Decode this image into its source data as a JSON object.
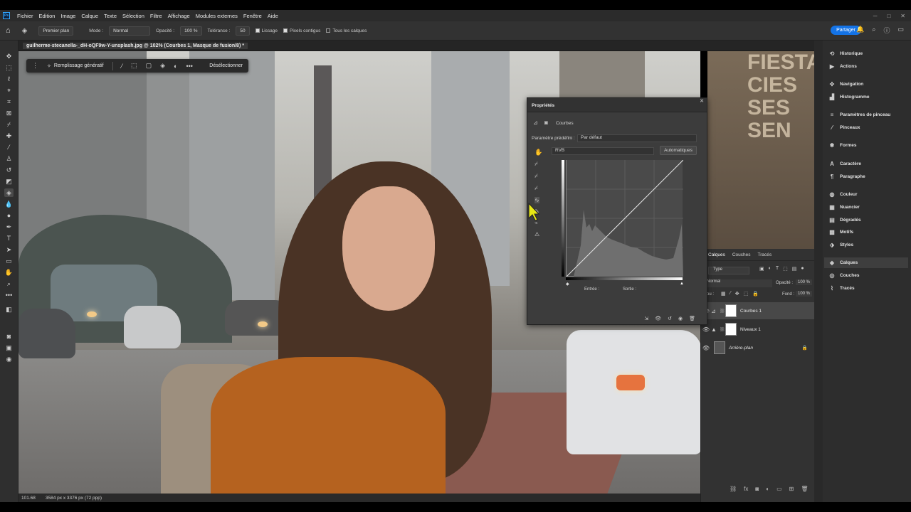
{
  "menu": {
    "items": [
      "Fichier",
      "Edition",
      "Image",
      "Calque",
      "Texte",
      "Sélection",
      "Filtre",
      "Affichage",
      "Modules externes",
      "Fenêtre",
      "Aide"
    ]
  },
  "options": {
    "fill_source": "Premier plan",
    "mode_label": "Mode :",
    "mode_value": "Normal",
    "opacity_label": "Opacité :",
    "opacity_value": "100 %",
    "tolerance_label": "Tolérance :",
    "tolerance_value": "50",
    "lissage": "Lissage",
    "pixels_contigus": "Pixels contigus",
    "tous_calques": "Tous les calques",
    "share": "Partager"
  },
  "document": {
    "tab_title": "guilherme-stecanella-_dH-oQF9w-Y-unsplash.jpg @ 102% (Courbes 1, Masque de fusion/8) *",
    "zoom": "101.68",
    "dimensions": "3584 px x 3376 px (72 ppp)"
  },
  "context_bar": {
    "generative": "Remplissage génératif",
    "deselect": "Désélectionner"
  },
  "properties": {
    "title": "Propriétés",
    "adjustment": "Courbes",
    "preset_label": "Paramètre prédéfini :",
    "preset_value": "Par défaut",
    "channel": "RVB",
    "auto": "Automatiques",
    "input_label": "Entrée :",
    "output_label": "Sortie :"
  },
  "layers": {
    "tabs": [
      "Calques",
      "Couches",
      "Tracés"
    ],
    "filter": "Type",
    "blend": "Normal",
    "opacity_label": "Opacité :",
    "opacity_value": "100 %",
    "lock_label": "rrou :",
    "fill_label": "Fond :",
    "fill_value": "100 %",
    "items": [
      {
        "name": "Courbes 1"
      },
      {
        "name": "Niveaux 1"
      },
      {
        "name": "Arrière-plan"
      }
    ]
  },
  "dock": {
    "items": [
      "Historique",
      "Actions",
      "Navigation",
      "Histogramme",
      "Paramètres de pinceau",
      "Pinceaux",
      "Formes",
      "Caractère",
      "Paragraphe",
      "Couleur",
      "Nuancier",
      "Dégradés",
      "Motifs",
      "Styles",
      "Calques",
      "Couches",
      "Tracés"
    ]
  },
  "canvas_text": {
    "sign": "FIESTA CIES SES SEN"
  },
  "colors": {
    "accent": "#1473e6",
    "panel": "#323232"
  }
}
